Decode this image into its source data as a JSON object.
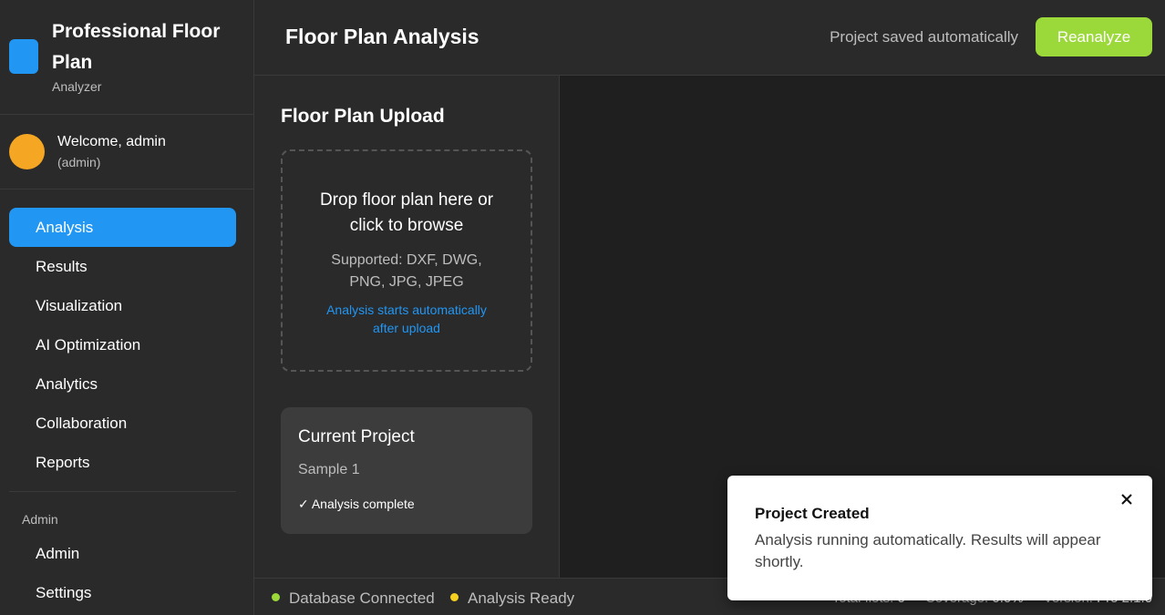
{
  "brand": {
    "title": "Professional Floor Plan",
    "subtitle": "Analyzer",
    "logo_color": "#2196f3"
  },
  "user": {
    "welcome": "Welcome, admin",
    "role": "(admin)",
    "avatar_color": "#f5a623"
  },
  "sidebar": {
    "items": [
      {
        "label": "Analysis",
        "active": true
      },
      {
        "label": "Results"
      },
      {
        "label": "Visualization"
      },
      {
        "label": "AI Optimization"
      },
      {
        "label": "Analytics"
      },
      {
        "label": "Collaboration"
      },
      {
        "label": "Reports"
      }
    ],
    "admin_section": "Admin",
    "admin_items": [
      {
        "label": "Admin"
      },
      {
        "label": "Settings"
      }
    ]
  },
  "header": {
    "title": "Floor Plan Analysis",
    "save_status": "Project saved automatically",
    "reanalyze_label": "Reanalyze",
    "accent": "#9bd83a"
  },
  "upload": {
    "title": "Floor Plan Upload",
    "drop_main": "Drop floor plan here or click to browse",
    "supported": "Supported: DXF, DWG, PNG, JPG, JPEG",
    "note": "Analysis starts automatically after upload"
  },
  "project": {
    "heading": "Current Project",
    "name": "Sample 1",
    "status": "✓ Analysis complete"
  },
  "statusbar": {
    "db": "Database Connected",
    "db_color": "#9bd83a",
    "analysis": "Analysis Ready",
    "analysis_color": "#f5d020",
    "total_ilots_label": "Total îlots:",
    "total_ilots_value": "0",
    "coverage_label": "Coverage:",
    "coverage_value": "0.0%",
    "version_label": "Version:",
    "version_value": "Pro 2.1.0"
  },
  "toast": {
    "title": "Project Created",
    "message": "Analysis running automatically. Results will appear shortly.",
    "close_icon": "close-icon"
  }
}
